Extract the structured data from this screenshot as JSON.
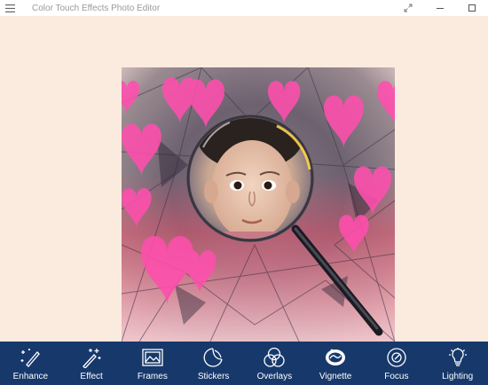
{
  "window": {
    "title": "Color Touch Effects Photo Editor",
    "menu_icon": "hamburger-icon",
    "controls": [
      "expand-icon",
      "minimize-icon",
      "maximize-icon"
    ]
  },
  "colors": {
    "background": "#fbeade",
    "toolbar": "#17386b",
    "toolbar_text": "#ffffff",
    "heart": "#ff4fae"
  },
  "toolbar": {
    "items": [
      {
        "label": "Enhance",
        "icon": "magic-wand-pencil-icon"
      },
      {
        "label": "Effect",
        "icon": "sparkle-wand-icon"
      },
      {
        "label": "Frames",
        "icon": "picture-frame-icon"
      },
      {
        "label": "Stickers",
        "icon": "sticker-peel-icon"
      },
      {
        "label": "Overlays",
        "icon": "overlapping-circles-icon"
      },
      {
        "label": "Vignette",
        "icon": "vignette-icon"
      },
      {
        "label": "Focus",
        "icon": "focus-target-icon"
      },
      {
        "label": "Lighting",
        "icon": "light-bulb-icon"
      }
    ]
  }
}
